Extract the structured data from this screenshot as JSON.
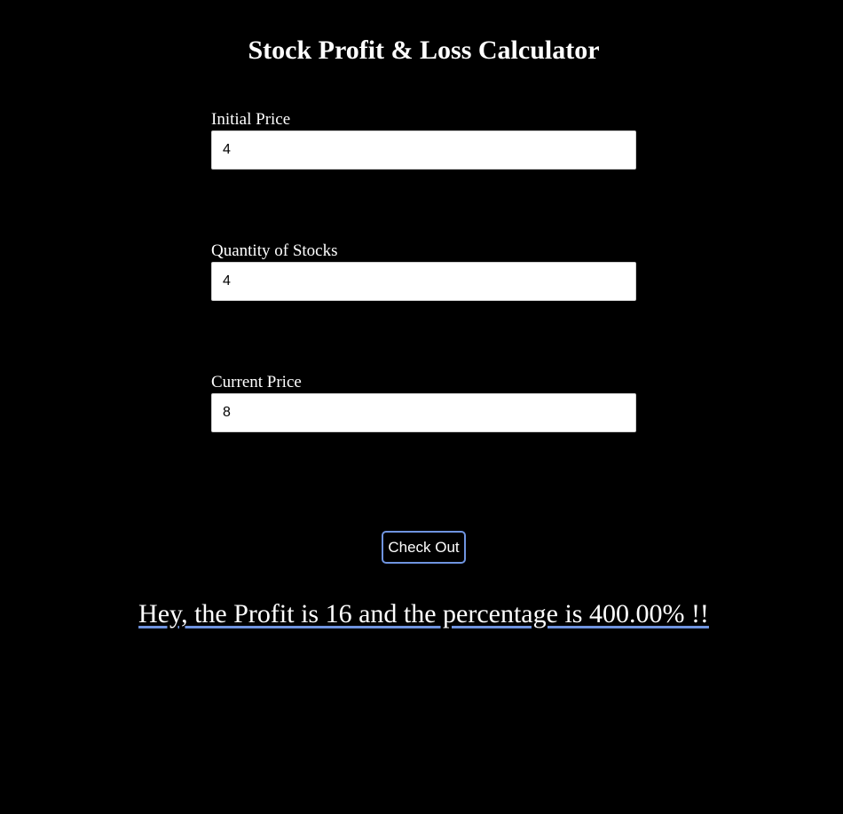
{
  "page": {
    "title": "Stock Profit & Loss Calculator"
  },
  "form": {
    "initial_price": {
      "label": "Initial Price",
      "value": "4"
    },
    "quantity": {
      "label": "Quantity of Stocks",
      "value": "4"
    },
    "current_price": {
      "label": "Current Price",
      "value": "8"
    },
    "submit_label": "Check Out"
  },
  "result": {
    "message": "Hey, the Profit is 16 and the percentage is 400.00% !!"
  },
  "colors": {
    "background": "#000000",
    "text": "#ffffff",
    "accent": "#6f94e0"
  }
}
